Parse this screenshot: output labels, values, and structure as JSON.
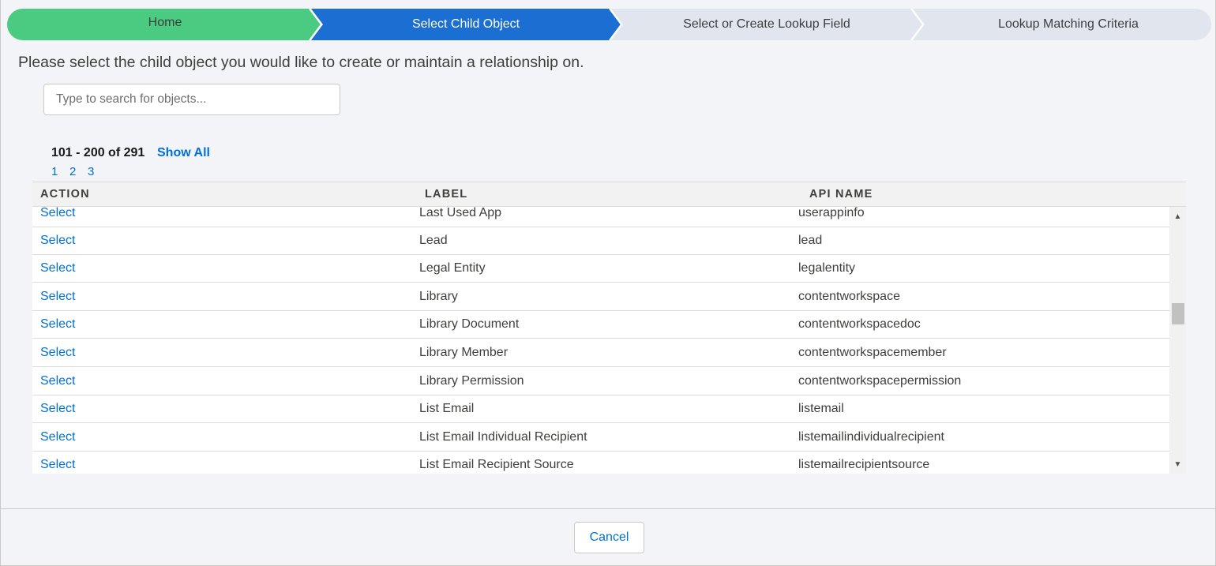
{
  "path": {
    "steps": [
      {
        "label": "Home",
        "state": "complete"
      },
      {
        "label": "Select Child Object",
        "state": "current"
      },
      {
        "label": "Select or Create Lookup Field",
        "state": "incomplete"
      },
      {
        "label": "Lookup Matching Criteria",
        "state": "incomplete"
      }
    ]
  },
  "prompt": "Please select the child object you would like to create or maintain a relationship on.",
  "search": {
    "placeholder": "Type to search for objects...",
    "value": ""
  },
  "pagination": {
    "range": "101 - 200 of 291",
    "show_all": "Show All",
    "pages": [
      "1",
      "2",
      "3"
    ]
  },
  "table": {
    "headers": [
      "ACTION",
      "LABEL",
      "API NAME"
    ],
    "rows": [
      {
        "action": "Select",
        "label": "Last Used App",
        "api": "userappinfo"
      },
      {
        "action": "Select",
        "label": "Lead",
        "api": "lead"
      },
      {
        "action": "Select",
        "label": "Legal Entity",
        "api": "legalentity"
      },
      {
        "action": "Select",
        "label": "Library",
        "api": "contentworkspace"
      },
      {
        "action": "Select",
        "label": "Library Document",
        "api": "contentworkspacedoc"
      },
      {
        "action": "Select",
        "label": "Library Member",
        "api": "contentworkspacemember"
      },
      {
        "action": "Select",
        "label": "Library Permission",
        "api": "contentworkspacepermission"
      },
      {
        "action": "Select",
        "label": "List Email",
        "api": "listemail"
      },
      {
        "action": "Select",
        "label": "List Email Individual Recipient",
        "api": "listemailindividualrecipient"
      },
      {
        "action": "Select",
        "label": "List Email Recipient Source",
        "api": "listemailrecipientsource"
      }
    ]
  },
  "footer": {
    "cancel_label": "Cancel"
  },
  "colors": {
    "complete": "#4bca81",
    "current": "#1b6ed2",
    "incomplete": "#e1e5ee",
    "link": "#0070d2"
  },
  "icons": {
    "scroll_up": "triangle-up-icon",
    "scroll_down": "triangle-down-icon"
  }
}
